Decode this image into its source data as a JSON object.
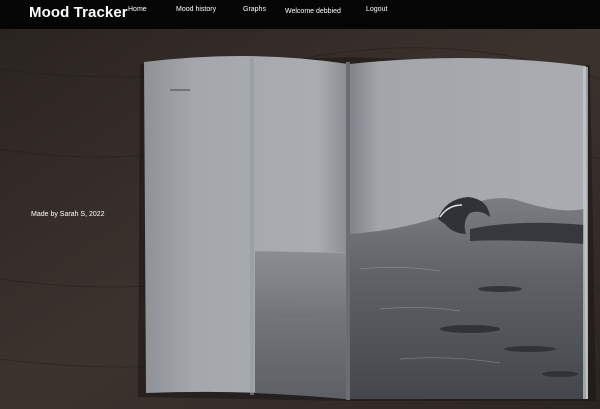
{
  "brand": {
    "title": "Mood Tracker"
  },
  "nav": {
    "home": "Home",
    "mood_history": "Mood history",
    "graphs": "Graphs",
    "welcome": "Welcome debbied",
    "logout": "Logout"
  },
  "footer": {
    "credit": "Made by Sarah S, 2022"
  },
  "colors": {
    "navbar_bg": "#050505",
    "nav_text": "#ffffff",
    "table_wood": "#3a322d",
    "page_paper": "#a7abb0"
  },
  "hero": {
    "image": "open-book-wave-photo"
  }
}
